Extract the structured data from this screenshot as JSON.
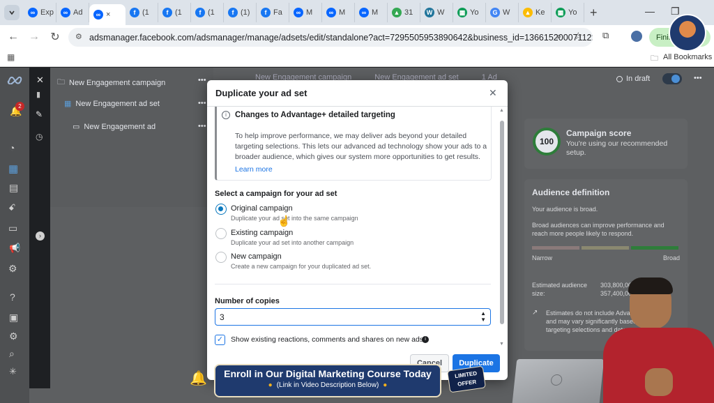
{
  "browser": {
    "tabs": [
      {
        "label": "Exp",
        "icon": "meta-icon"
      },
      {
        "label": "Ad",
        "icon": "meta-icon"
      },
      {
        "label": "×",
        "icon": "meta-icon",
        "active": true
      },
      {
        "label": "(1",
        "icon": "facebook-icon"
      },
      {
        "label": "(1",
        "icon": "facebook-icon"
      },
      {
        "label": "(1",
        "icon": "facebook-icon"
      },
      {
        "label": "(1)",
        "icon": "facebook-icon"
      },
      {
        "label": "Fa",
        "icon": "facebook-icon"
      },
      {
        "label": "M",
        "icon": "meta-icon"
      },
      {
        "label": "M",
        "icon": "meta-icon"
      },
      {
        "label": "M",
        "icon": "meta-icon"
      },
      {
        "label": "31",
        "icon": "drive-icon"
      },
      {
        "label": "W",
        "icon": "wordpress-icon"
      },
      {
        "label": "Yo",
        "icon": "sheets-icon"
      },
      {
        "label": "W",
        "icon": "google-icon"
      },
      {
        "label": "Ke",
        "icon": "ads-icon"
      },
      {
        "label": "Yo",
        "icon": "sheets-icon"
      }
    ],
    "new_tab": "+",
    "url": "adsmanager.facebook.com/adsmanager/manage/adsets/edit/standalone?act=7295505953890642&business_id=1366152000711229...",
    "finish_label": "Finis",
    "all_bookmarks": "All Bookmarks"
  },
  "tree": {
    "campaign": "New Engagement campaign",
    "adset": "New Engagement ad set",
    "ad": "New Engagement ad",
    "more": "•••"
  },
  "topbar": {
    "breadcrumb_campaign": "New Engagement campaign",
    "breadcrumb_adset": "New Engagement ad set",
    "breadcrumb_ad": "1 Ad",
    "status": "In draft",
    "more": "•••"
  },
  "notification_count": "2",
  "campaign_score": {
    "value": "100",
    "title": "Campaign score",
    "desc": "You're using our recommended setup."
  },
  "audience": {
    "title": "Audience definition",
    "line1": "Your audience is broad.",
    "line2": "Broad audiences can improve performance and reach more people likely to respond.",
    "narrow": "Narrow",
    "broad": "Broad",
    "est_label": "Estimated audience size:",
    "est_value": "303,800,000 - 357,400,000",
    "note": "Estimates do not include Advantage+ options and may vary significantly based on your targeting selections and data."
  },
  "modal": {
    "title": "Duplicate your ad set",
    "info_title": "Changes to Advantage+ detailed targeting",
    "info_body": "To help improve performance, we may deliver ads beyond your detailed targeting selections. This lets our advanced ad technology show your ads to a broader audience, which gives our system more opportunities to get results.",
    "learn_more": "Learn more",
    "select_label": "Select a campaign for your ad set",
    "options": [
      {
        "title": "Original campaign",
        "desc": "Duplicate your ad set into the same campaign",
        "selected": true
      },
      {
        "title": "Existing campaign",
        "desc": "Duplicate your ad set into another campaign",
        "selected": false
      },
      {
        "title": "New campaign",
        "desc": "Create a new campaign for your duplicated ad set.",
        "selected": false
      }
    ],
    "copies_label": "Number of copies",
    "copies_value": "3",
    "show_reactions": "Show existing reactions, comments and shares on new ads",
    "cancel": "Cancel",
    "duplicate": "Duplicate"
  },
  "overlay": {
    "banner_title": "Enroll in Our Digital Marketing Course Today",
    "banner_sub": "(Link in Video Description Below)",
    "badge_top": "LIMITED",
    "badge_bottom": "OFFER"
  },
  "colors": {
    "primary": "#1b74e4",
    "radio": "#0a78be",
    "banner": "#1f3a6e"
  }
}
